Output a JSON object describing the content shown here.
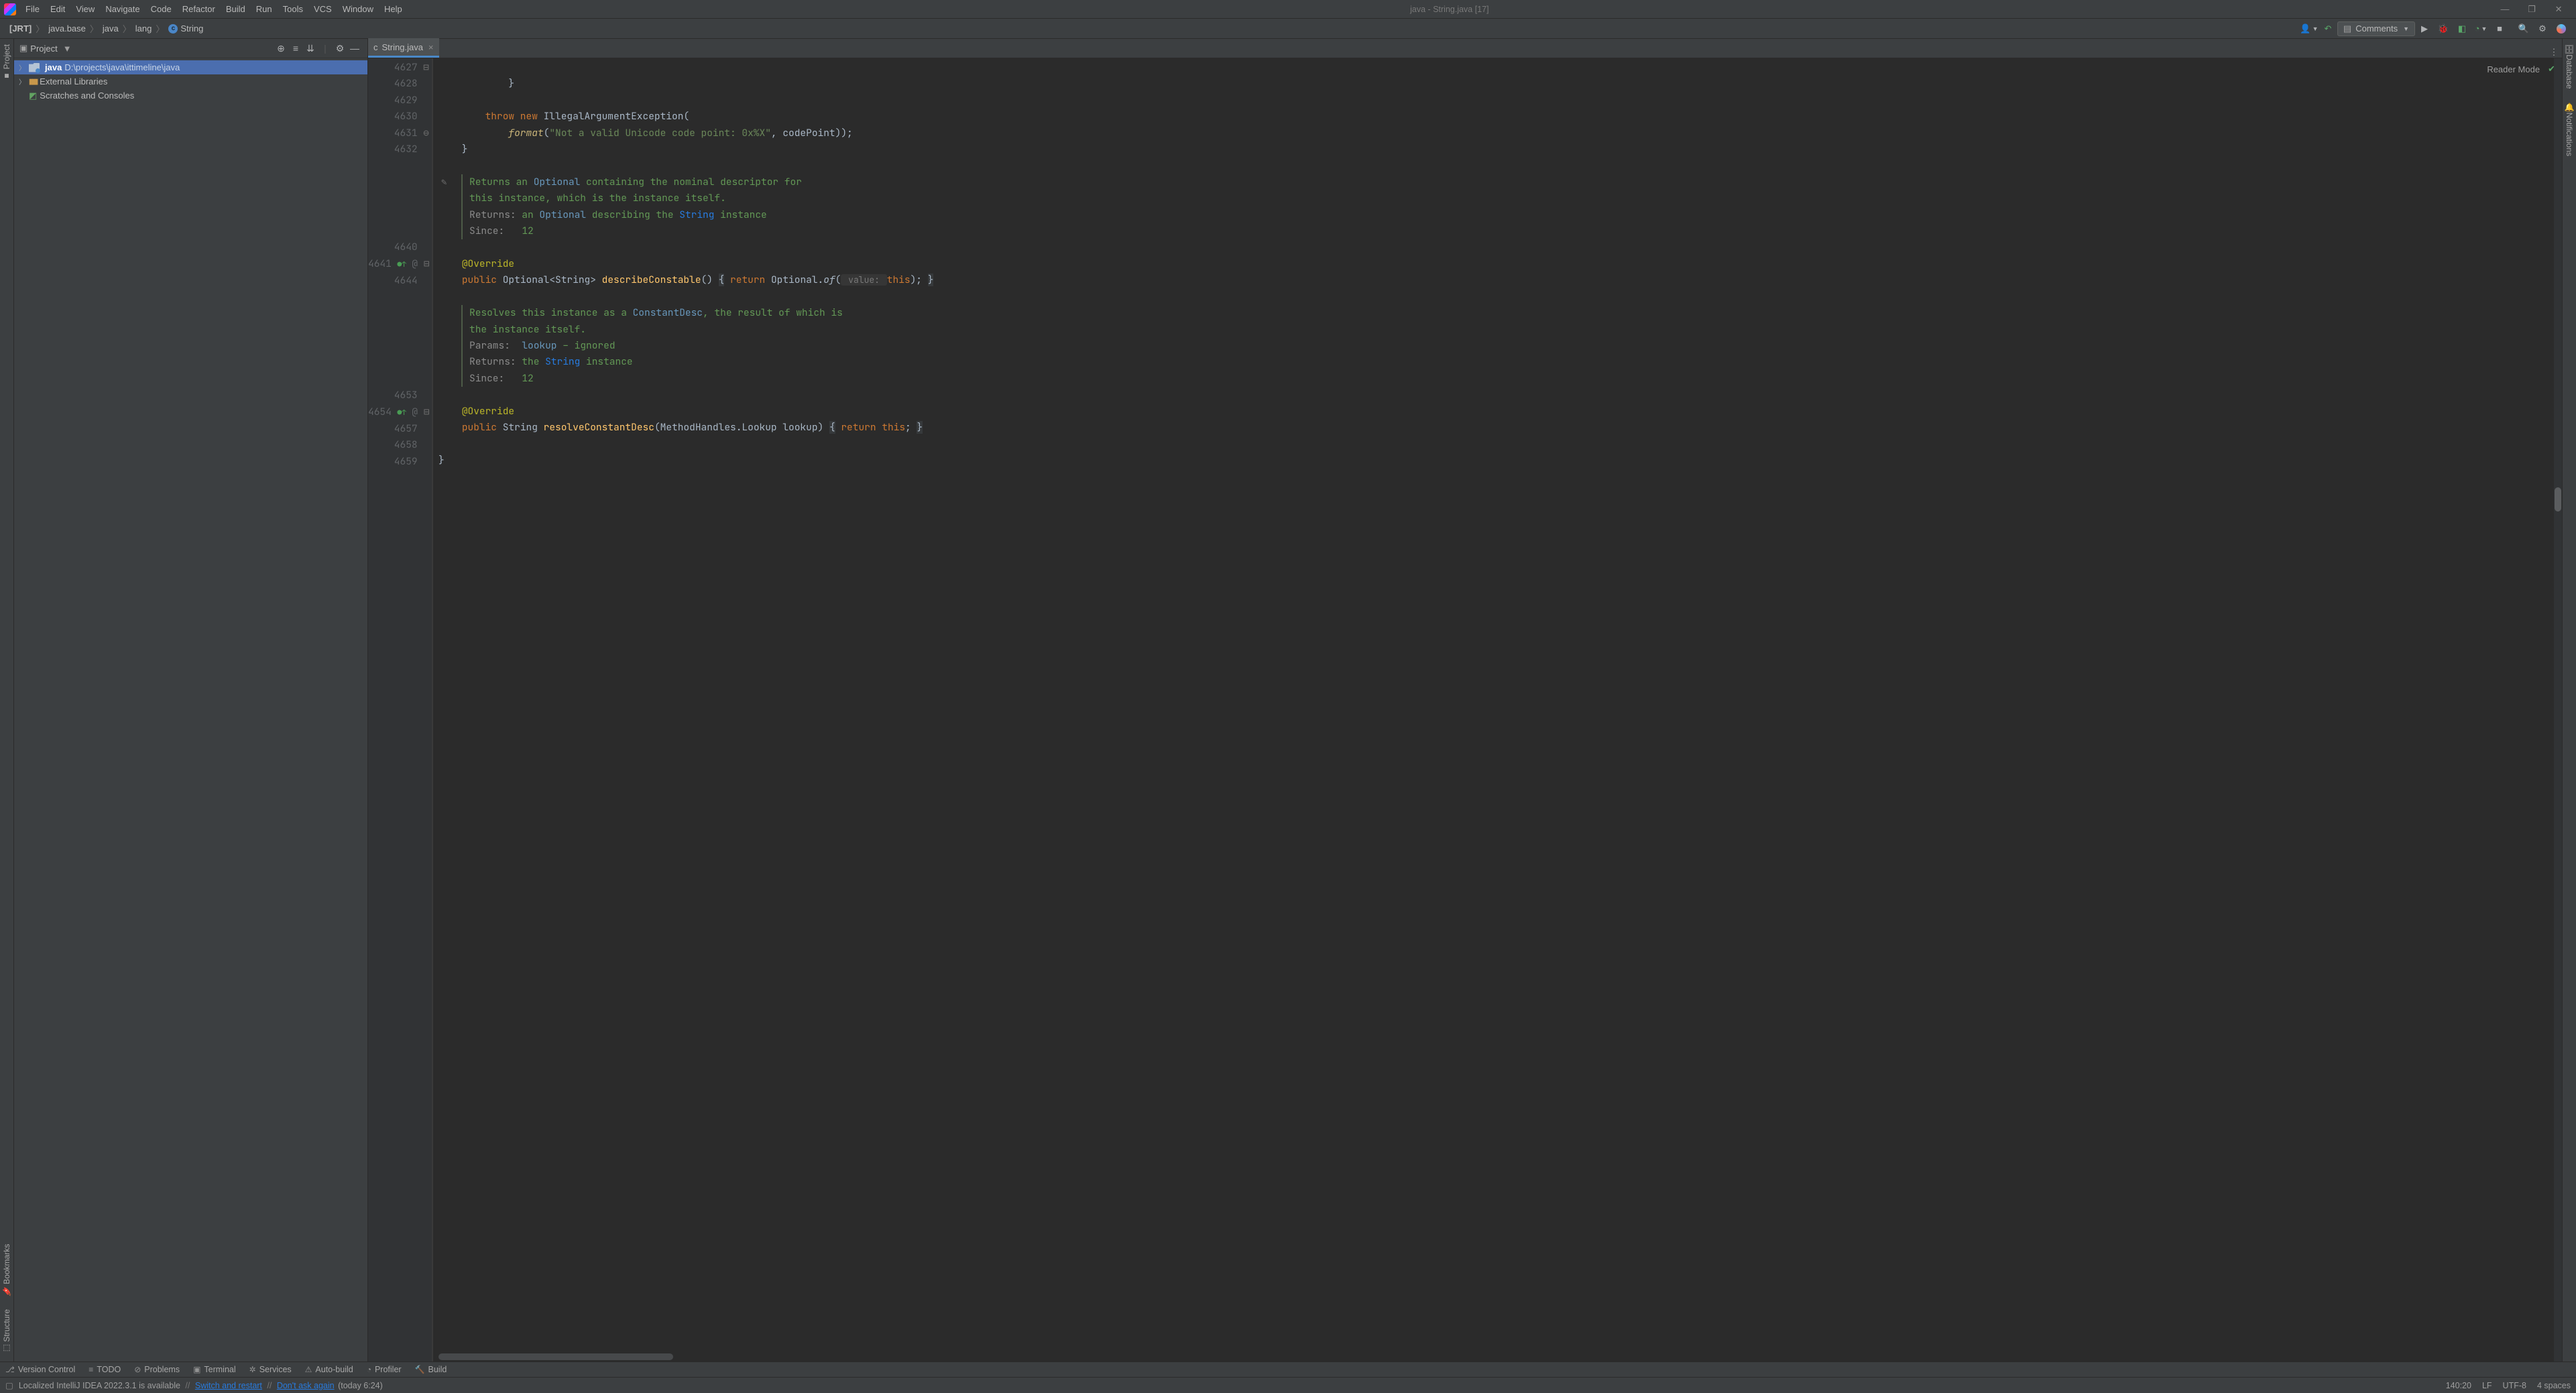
{
  "window": {
    "title": "java - String.java [17]"
  },
  "menu": [
    "File",
    "Edit",
    "View",
    "Navigate",
    "Code",
    "Refactor",
    "Build",
    "Run",
    "Tools",
    "VCS",
    "Window",
    "Help"
  ],
  "breadcrumb": {
    "root": "[JRT]",
    "items": [
      "java.base",
      "java",
      "lang",
      "String"
    ]
  },
  "toolbar": {
    "inspection_label": "Comments"
  },
  "project_pane": {
    "title": "Project",
    "root_name": "java",
    "root_path": "D:\\projects\\java\\ittimeline\\java",
    "ext_libs": "External Libraries",
    "scratches": "Scratches and Consoles"
  },
  "tab": {
    "label": "String.java"
  },
  "reader_mode": "Reader Mode",
  "gutter_lines": [
    "4627",
    "4628",
    "4629",
    "4630",
    "4631",
    "4632",
    "",
    "",
    "",
    "",
    "",
    "4640",
    "4641",
    "4644",
    "",
    "",
    "",
    "",
    "",
    "",
    "4653",
    "4654",
    "4657",
    "4658",
    "4659"
  ],
  "code": {
    "l4627": "            }",
    "l4629a": "        throw new ",
    "l4629b": "IllegalArgumentException(",
    "l4630a": "            format(",
    "l4630b": "\"Not a valid Unicode code point: 0x%X\"",
    "l4630c": ", codePoint));",
    "l4631": "    }",
    "doc1a": "Returns an ",
    "doc1b": "Optional",
    "doc1c": " containing the nominal descriptor for",
    "doc1d": "this instance, which is the instance itself.",
    "doc1e": "Returns:",
    "doc1f": " an ",
    "doc1g": "Optional",
    "doc1h": " describing the ",
    "doc1i": "String",
    "doc1j": " instance",
    "doc1k": "Since:",
    "doc1l": "12",
    "l4640": "    @Override",
    "l4641a": "    public ",
    "l4641b": "Optional<String> ",
    "l4641c": "describeConstable",
    "l4641d": "() ",
    "l4641e": "{ ",
    "l4641f": "return ",
    "l4641g": "Optional.",
    "l4641h": "of",
    "l4641i": "(",
    "l4641hint": " value: ",
    "l4641j": "this",
    "l4641k": "); ",
    "l4641l": "}",
    "doc2a": "Resolves this instance as a ",
    "doc2b": "ConstantDesc",
    "doc2c": ", the result of which is",
    "doc2d": "the instance itself.",
    "doc2e": "Params:",
    "doc2f": "lookup",
    "doc2g": " – ignored",
    "doc2h": "Returns:",
    "doc2i": " the ",
    "doc2j": "String",
    "doc2k": " instance",
    "doc2l": "Since:",
    "doc2m": "12",
    "l4653": "    @Override",
    "l4654a": "    public ",
    "l4654b": "String ",
    "l4654c": "resolveConstantDesc",
    "l4654d": "(MethodHandles.Lookup lookup) ",
    "l4654e": "{ ",
    "l4654f": "return this",
    "l4654g": "; ",
    "l4654h": "}",
    "l4658": "}"
  },
  "leftrail": {
    "project": "Project",
    "bookmarks": "Bookmarks",
    "structure": "Structure"
  },
  "rightrail": {
    "database": "Database",
    "notifications": "Notifications"
  },
  "bottom_tools": {
    "vcs": "Version Control",
    "todo": "TODO",
    "problems": "Problems",
    "terminal": "Terminal",
    "services": "Services",
    "autobuild": "Auto-build",
    "profiler": "Profiler",
    "build": "Build"
  },
  "status": {
    "msg1": "Localized IntelliJ IDEA 2022.3.1 is available",
    "link1": "Switch and restart",
    "link2": "Don't ask again",
    "link2_suffix": "(today 6:24)",
    "caret": "140:20",
    "linesep": "LF",
    "encoding": "UTF-8",
    "indent": "4 spaces"
  }
}
